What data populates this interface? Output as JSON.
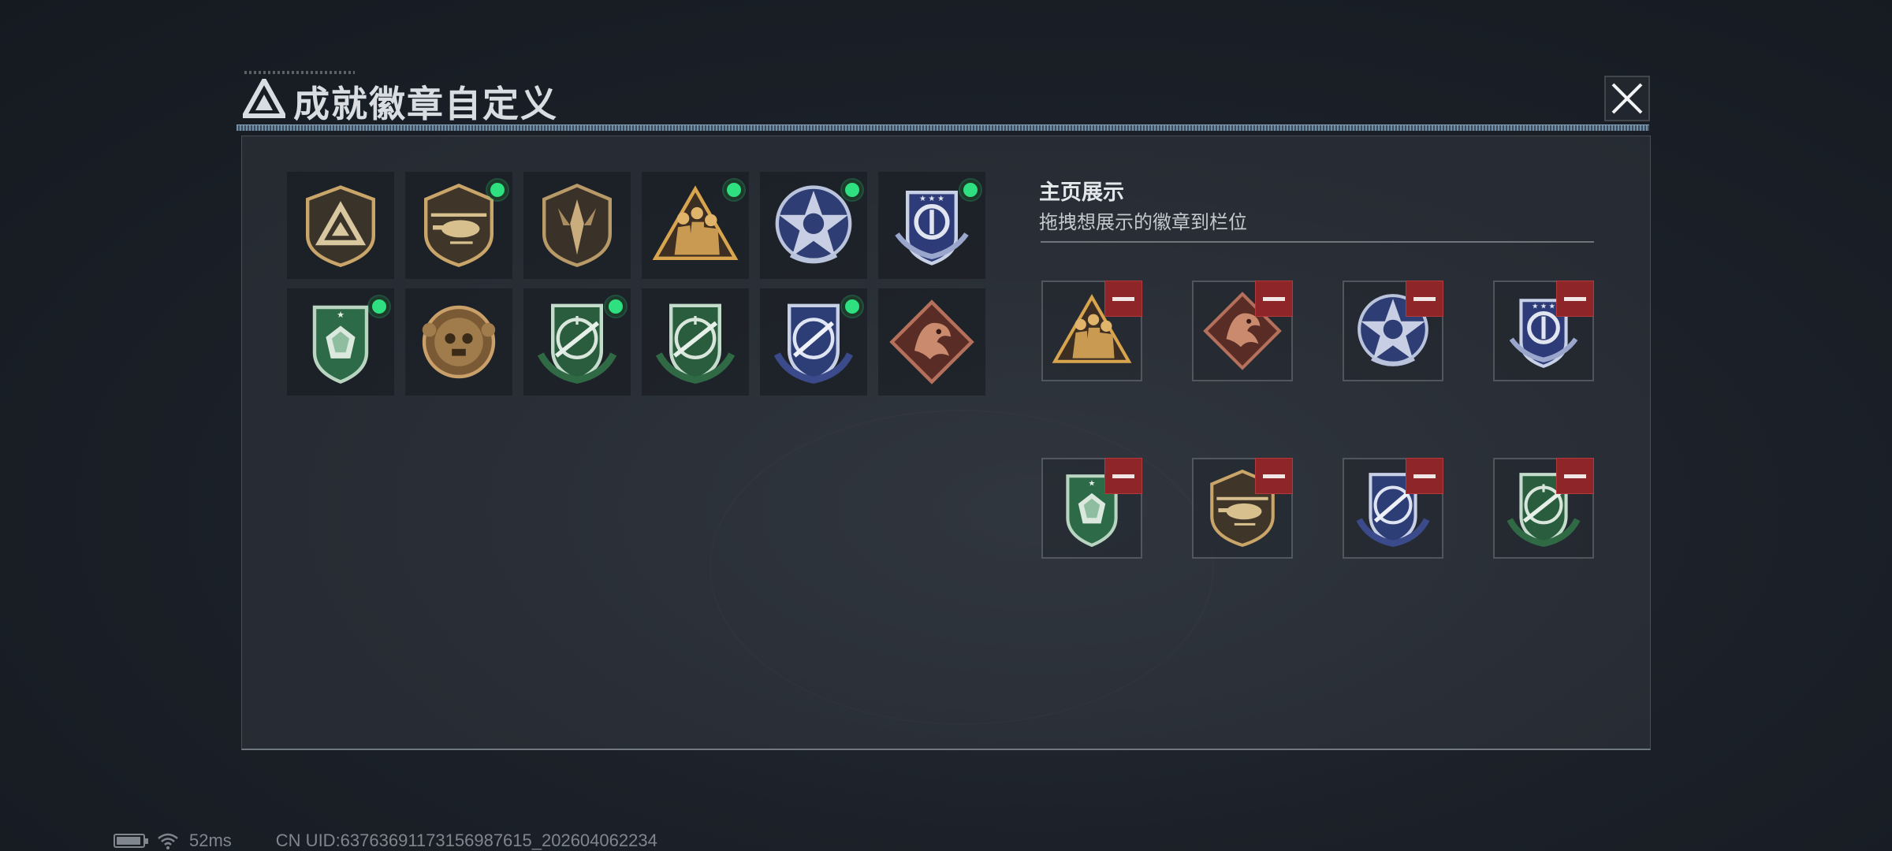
{
  "header": {
    "title": "成就徽章自定义",
    "logo_icon": "triangle-logo-icon",
    "close_icon": "close-icon"
  },
  "showcase": {
    "heading": "主页展示",
    "subtitle": "拖拽想展示的徽章到栏位",
    "slots": [
      {
        "badge": "tri-soldiers-badge-icon"
      },
      {
        "badge": "dragon-badge-icon"
      },
      {
        "badge": "blue-star-badge-icon"
      },
      {
        "badge": "blue-wing-badge-icon"
      },
      {
        "badge": "green-gem-badge-icon"
      },
      {
        "badge": "helicopter-badge-icon"
      },
      {
        "badge": "blue-target-badge-icon"
      },
      {
        "badge": "green-rifle-badge-icon"
      }
    ]
  },
  "inventory": [
    {
      "badge": "tri-logo-badge-icon",
      "equipped": false
    },
    {
      "badge": "helicopter-badge-icon",
      "equipped": true
    },
    {
      "badge": "dagger-badge-icon",
      "equipped": false
    },
    {
      "badge": "tri-soldiers-badge-icon",
      "equipped": true
    },
    {
      "badge": "blue-star-badge-icon",
      "equipped": true
    },
    {
      "badge": "blue-wing-badge-icon",
      "equipped": true
    },
    {
      "badge": "green-gem-badge-icon",
      "equipped": true
    },
    {
      "badge": "bronze-skull-badge-icon",
      "equipped": false
    },
    {
      "badge": "green-rifle-badge-icon",
      "equipped": true
    },
    {
      "badge": "green-rifle-badge-icon",
      "equipped": false
    },
    {
      "badge": "blue-target-badge-icon",
      "equipped": true
    },
    {
      "badge": "dragon-badge-icon",
      "equipped": false
    }
  ],
  "status": {
    "ping": "52ms",
    "uid": "CN UID:6376369117315698761​5_202604062234"
  },
  "colors": {
    "equipped_dot": "#2ee07f",
    "remove_button": "#8e2528",
    "gold": "#c9a56a",
    "blue": "#3d4f8f",
    "green": "#2f6a45"
  }
}
